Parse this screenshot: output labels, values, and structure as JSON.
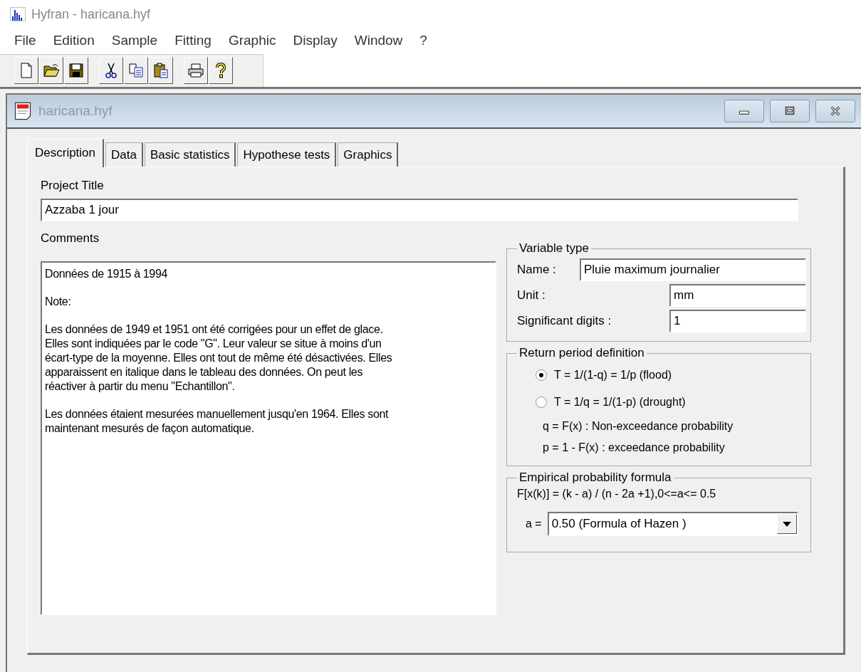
{
  "app": {
    "title": "Hyfran - haricana.hyf"
  },
  "menu": [
    "File",
    "Edition",
    "Sample",
    "Fitting",
    "Graphic",
    "Display",
    "Window",
    "?"
  ],
  "toolbar": [
    {
      "kind": "new"
    },
    {
      "kind": "open"
    },
    {
      "kind": "save"
    },
    {
      "kind": "cut"
    },
    {
      "kind": "copy"
    },
    {
      "kind": "paste"
    },
    {
      "kind": "print"
    },
    {
      "kind": "help"
    }
  ],
  "document_window": {
    "title": "haricana.hyf"
  },
  "tabs": [
    {
      "label": "Description",
      "selected": true
    },
    {
      "label": "Data",
      "selected": false
    },
    {
      "label": "Basic statistics",
      "selected": false
    },
    {
      "label": "Hypothese tests",
      "selected": false
    },
    {
      "label": "Graphics",
      "selected": false
    }
  ],
  "project_title": {
    "label": "Project Title",
    "value": "Azzaba 1 jour"
  },
  "comments": {
    "label": "Comments",
    "paragraphs": [
      [
        "Données de 1915 à 1994"
      ],
      [
        "Note:"
      ],
      [
        "Les données de 1949 et 1951 ont été corrigées pour un effet de glace.",
        "Elles sont indiquées par le code \"G\". Leur valeur se situe à moins d'un",
        "écart-type de la moyenne. Elles ont tout de même été désactivées. Elles",
        "apparaissent en italique dans le tableau des données. On peut les",
        "réactiver à partir du menu \"Echantillon\"."
      ],
      [
        "Les données étaient mesurées manuellement jusqu'en 1964. Elles sont",
        "maintenant mesurés de façon automatique."
      ]
    ]
  },
  "variable_type": {
    "title": "Variable type",
    "fields": [
      {
        "label": "Name :",
        "value": "Pluie maximum journalier",
        "kind": "wide"
      },
      {
        "label": "Unit :",
        "value": "mm",
        "kind": "short"
      },
      {
        "label": "Significant digits :",
        "value": "1",
        "kind": "short"
      }
    ]
  },
  "return_period": {
    "title": "Return period definition",
    "options": [
      {
        "label": "T = 1/(1-q)  = 1/p (flood)",
        "selected": true
      },
      {
        "label": "T = 1/q = 1/(1-p) (drought)",
        "selected": false
      }
    ],
    "notes": [
      "q = F(x) : Non-exceedance probability",
      "p = 1 - F(x) : exceedance probability"
    ]
  },
  "empirical_formula": {
    "title": "Empirical probability formula",
    "formula": "F[x(k)] = (k - a) / (n - 2a +1),0<=a<= 0.5",
    "select_label": "a =",
    "select_value": "0.50 (Formula of  Hazen )"
  }
}
